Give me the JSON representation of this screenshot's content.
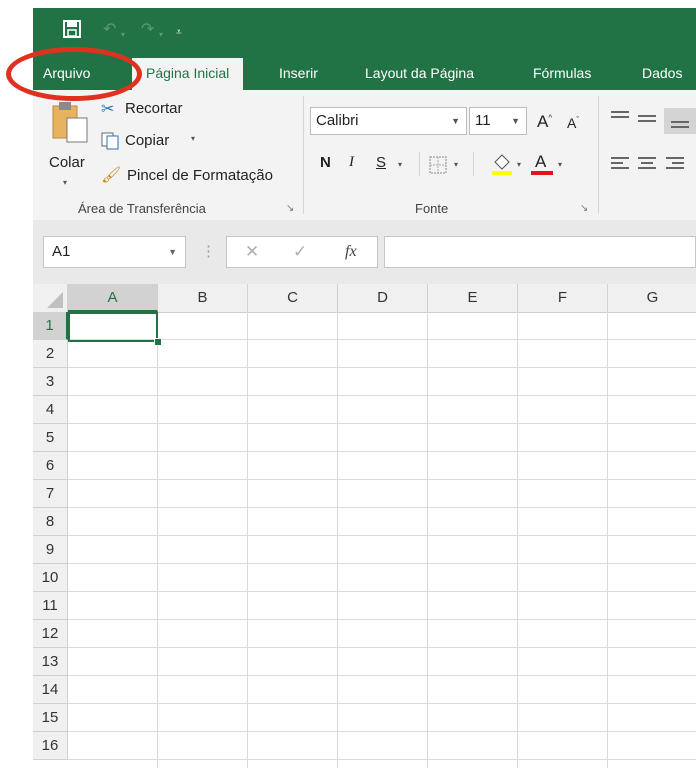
{
  "quick_access": {
    "save_icon": "save-icon",
    "undo_icon": "undo-icon",
    "redo_icon": "redo-icon",
    "customize_icon": "customize-quick-access-icon"
  },
  "tabs": [
    {
      "label": "Arquivo"
    },
    {
      "label": "Página Inicial"
    },
    {
      "label": "Inserir"
    },
    {
      "label": "Layout da Página"
    },
    {
      "label": "Fórmulas"
    },
    {
      "label": "Dados"
    }
  ],
  "ribbon": {
    "clipboard": {
      "paste_label": "Colar",
      "cut_label": "Recortar",
      "copy_label": "Copiar",
      "format_painter_label": "Pincel de Formatação",
      "group_label": "Área de Transferência"
    },
    "font": {
      "font_name": "Calibri",
      "font_size": "11",
      "bold": "N",
      "italic": "I",
      "underline": "S",
      "increase_size": "A",
      "decrease_size": "A",
      "font_color_letter": "A",
      "group_label": "Fonte"
    }
  },
  "formula_bar": {
    "name_box": "A1",
    "cancel_symbol": "✕",
    "enter_symbol": "✓",
    "fx_symbol": "fx",
    "dots": "⋮",
    "formula": ""
  },
  "grid": {
    "columns": [
      "A",
      "B",
      "C",
      "D",
      "E",
      "F",
      "G"
    ],
    "rows": [
      "1",
      "2",
      "3",
      "4",
      "5",
      "6",
      "7",
      "8",
      "9",
      "10",
      "11",
      "12",
      "13",
      "14",
      "15",
      "16"
    ],
    "active_cell": "A1"
  },
  "colors": {
    "accent": "#217346",
    "annotation": "#e0311f",
    "font_color_underline": "#e81123",
    "highlight_underline": "#ffff00"
  }
}
